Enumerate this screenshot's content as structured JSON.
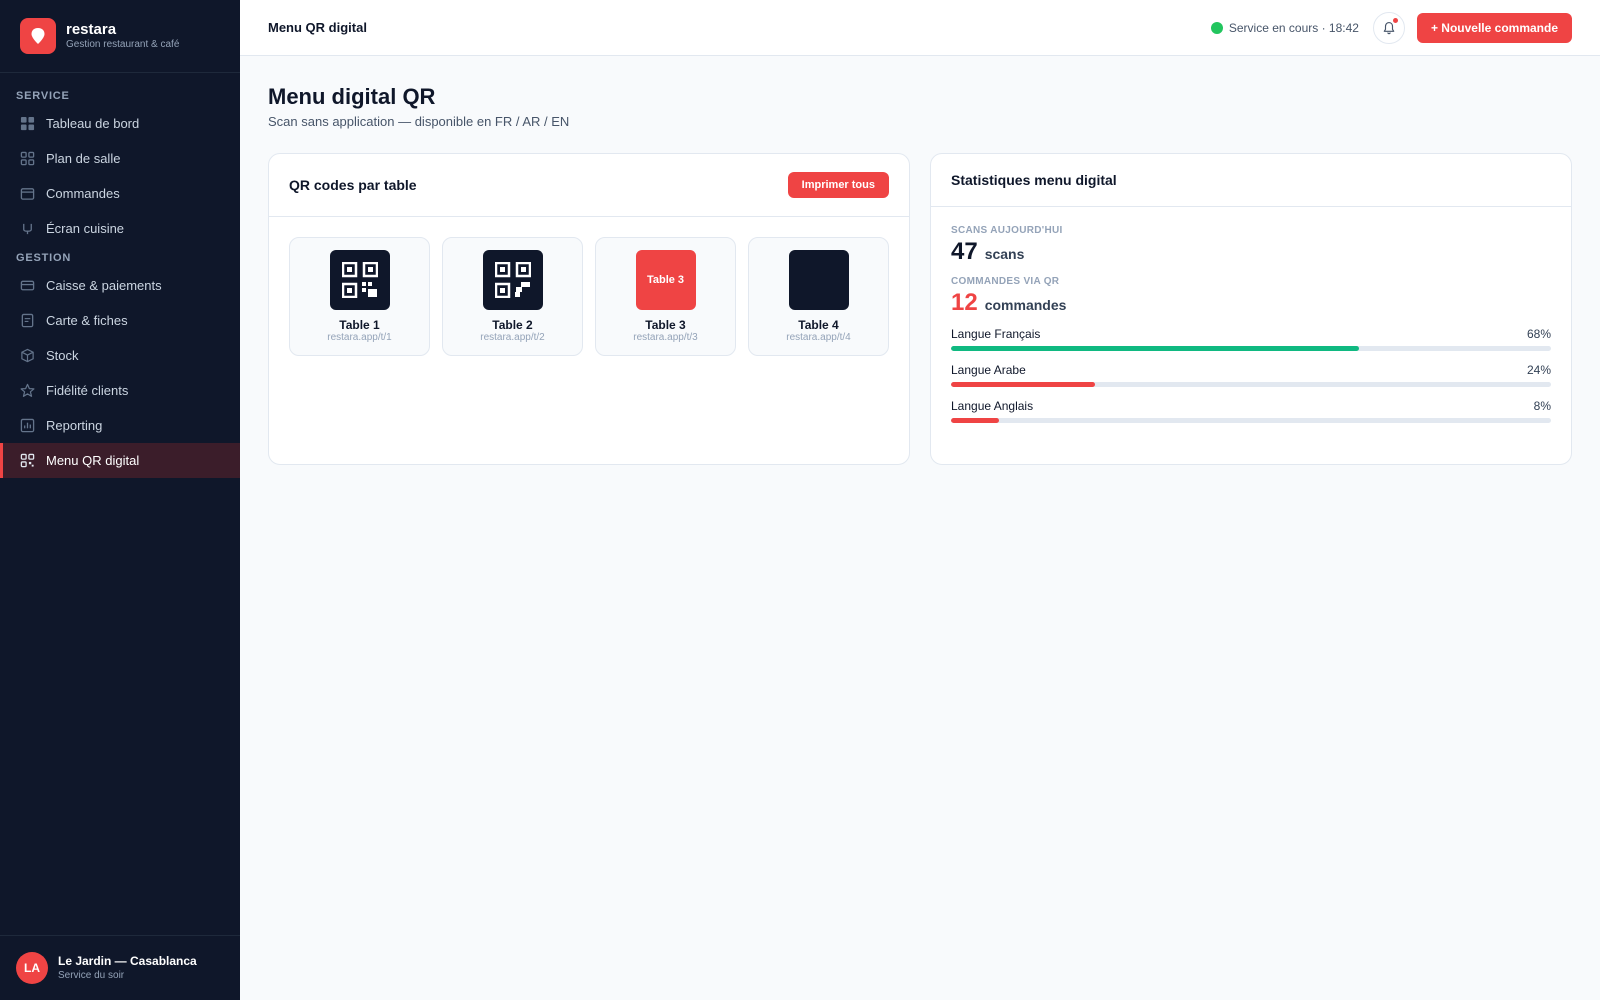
{
  "brand": {
    "name": "restara",
    "subtitle": "Gestion restaurant & café"
  },
  "sidebar": {
    "sections": [
      {
        "label": "SERVICE",
        "items": [
          {
            "label": "Tableau de bord",
            "icon": "grid-icon"
          },
          {
            "label": "Plan de salle",
            "icon": "layout-icon"
          },
          {
            "label": "Commandes",
            "icon": "box-icon"
          },
          {
            "label": "Écran cuisine",
            "icon": "bowl-icon"
          }
        ]
      },
      {
        "label": "GESTION",
        "items": [
          {
            "label": "Caisse & paiements",
            "icon": "card-icon"
          },
          {
            "label": "Carte & fiches",
            "icon": "document-icon"
          },
          {
            "label": "Stock",
            "icon": "package-icon"
          },
          {
            "label": "Fidélité clients",
            "icon": "star-icon"
          },
          {
            "label": "Reporting",
            "icon": "chart-icon"
          },
          {
            "label": "Menu QR digital",
            "icon": "qr-icon",
            "active": true
          }
        ]
      }
    ],
    "footer": {
      "initials": "LA",
      "name": "Le Jardin — Casablanca",
      "subtitle": "Service du soir"
    }
  },
  "topbar": {
    "title": "Menu QR digital",
    "status": "Service en cours · 18:42",
    "new_order_label": "+ Nouvelle commande"
  },
  "page": {
    "title": "Menu digital QR",
    "subtitle": "Scan sans application — disponible en FR / AR / EN"
  },
  "qr_card": {
    "title": "QR codes par table",
    "print_label": "Imprimer tous",
    "tables": [
      {
        "name": "Table 1",
        "url": "restara.app/t/1"
      },
      {
        "name": "Table 2",
        "url": "restara.app/t/2"
      },
      {
        "name": "Table 3",
        "url": "restara.app/t/3",
        "badge": "Table 3"
      },
      {
        "name": "Table 4",
        "url": "restara.app/t/4"
      }
    ]
  },
  "stats_card": {
    "title": "Statistiques menu digital",
    "scans_label": "SCANS AUJOURD'HUI",
    "scans_value": "47",
    "scans_unit": "scans",
    "orders_label": "COMMANDES VIA QR",
    "orders_value": "12",
    "orders_unit": "commandes",
    "languages": [
      {
        "label": "Langue Français",
        "pct_text": "68%",
        "pct": 68,
        "color": "#10b981"
      },
      {
        "label": "Langue Arabe",
        "pct_text": "24%",
        "pct": 24,
        "color": "#ef4444"
      },
      {
        "label": "Langue Anglais",
        "pct_text": "8%",
        "pct": 8,
        "color": "#ef4444"
      }
    ]
  },
  "colors": {
    "accent": "#ef4444",
    "sidebar_bg": "#0f172a",
    "success": "#22c55e"
  }
}
